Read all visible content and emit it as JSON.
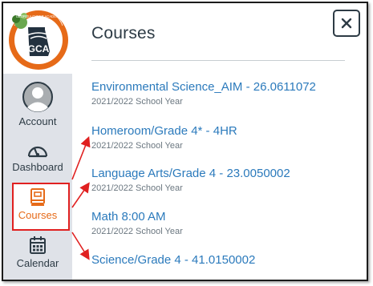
{
  "sidebar": {
    "logo": {
      "acronym": "GCA",
      "arc_text": "GEORGIA CYBER ACADEMY"
    },
    "items": [
      {
        "label": "Account",
        "icon": "avatar-icon"
      },
      {
        "label": "Dashboard",
        "icon": "speedometer-icon"
      },
      {
        "label": "Courses",
        "icon": "book-icon",
        "active": true
      },
      {
        "label": "Calendar",
        "icon": "calendar-icon"
      }
    ]
  },
  "tray": {
    "title": "Courses",
    "close_symbol": "×",
    "courses": [
      {
        "name": "Environmental Science_AIM - 26.0611072",
        "term": "2021/2022 School Year"
      },
      {
        "name": "Homeroom/Grade 4* - 4HR",
        "term": "2021/2022 School Year"
      },
      {
        "name": "Language Arts/Grade 4 - 23.0050002",
        "term": "2021/2022 School Year"
      },
      {
        "name": "Math 8:00 AM",
        "term": "2021/2022 School Year"
      },
      {
        "name": "Science/Grade 4 - 41.0150002",
        "term": ""
      }
    ]
  },
  "colors": {
    "link": "#2b7abc",
    "active": "#e66a18",
    "annotation": "#e02020",
    "sidebar_bg": "#dfe2e8"
  }
}
